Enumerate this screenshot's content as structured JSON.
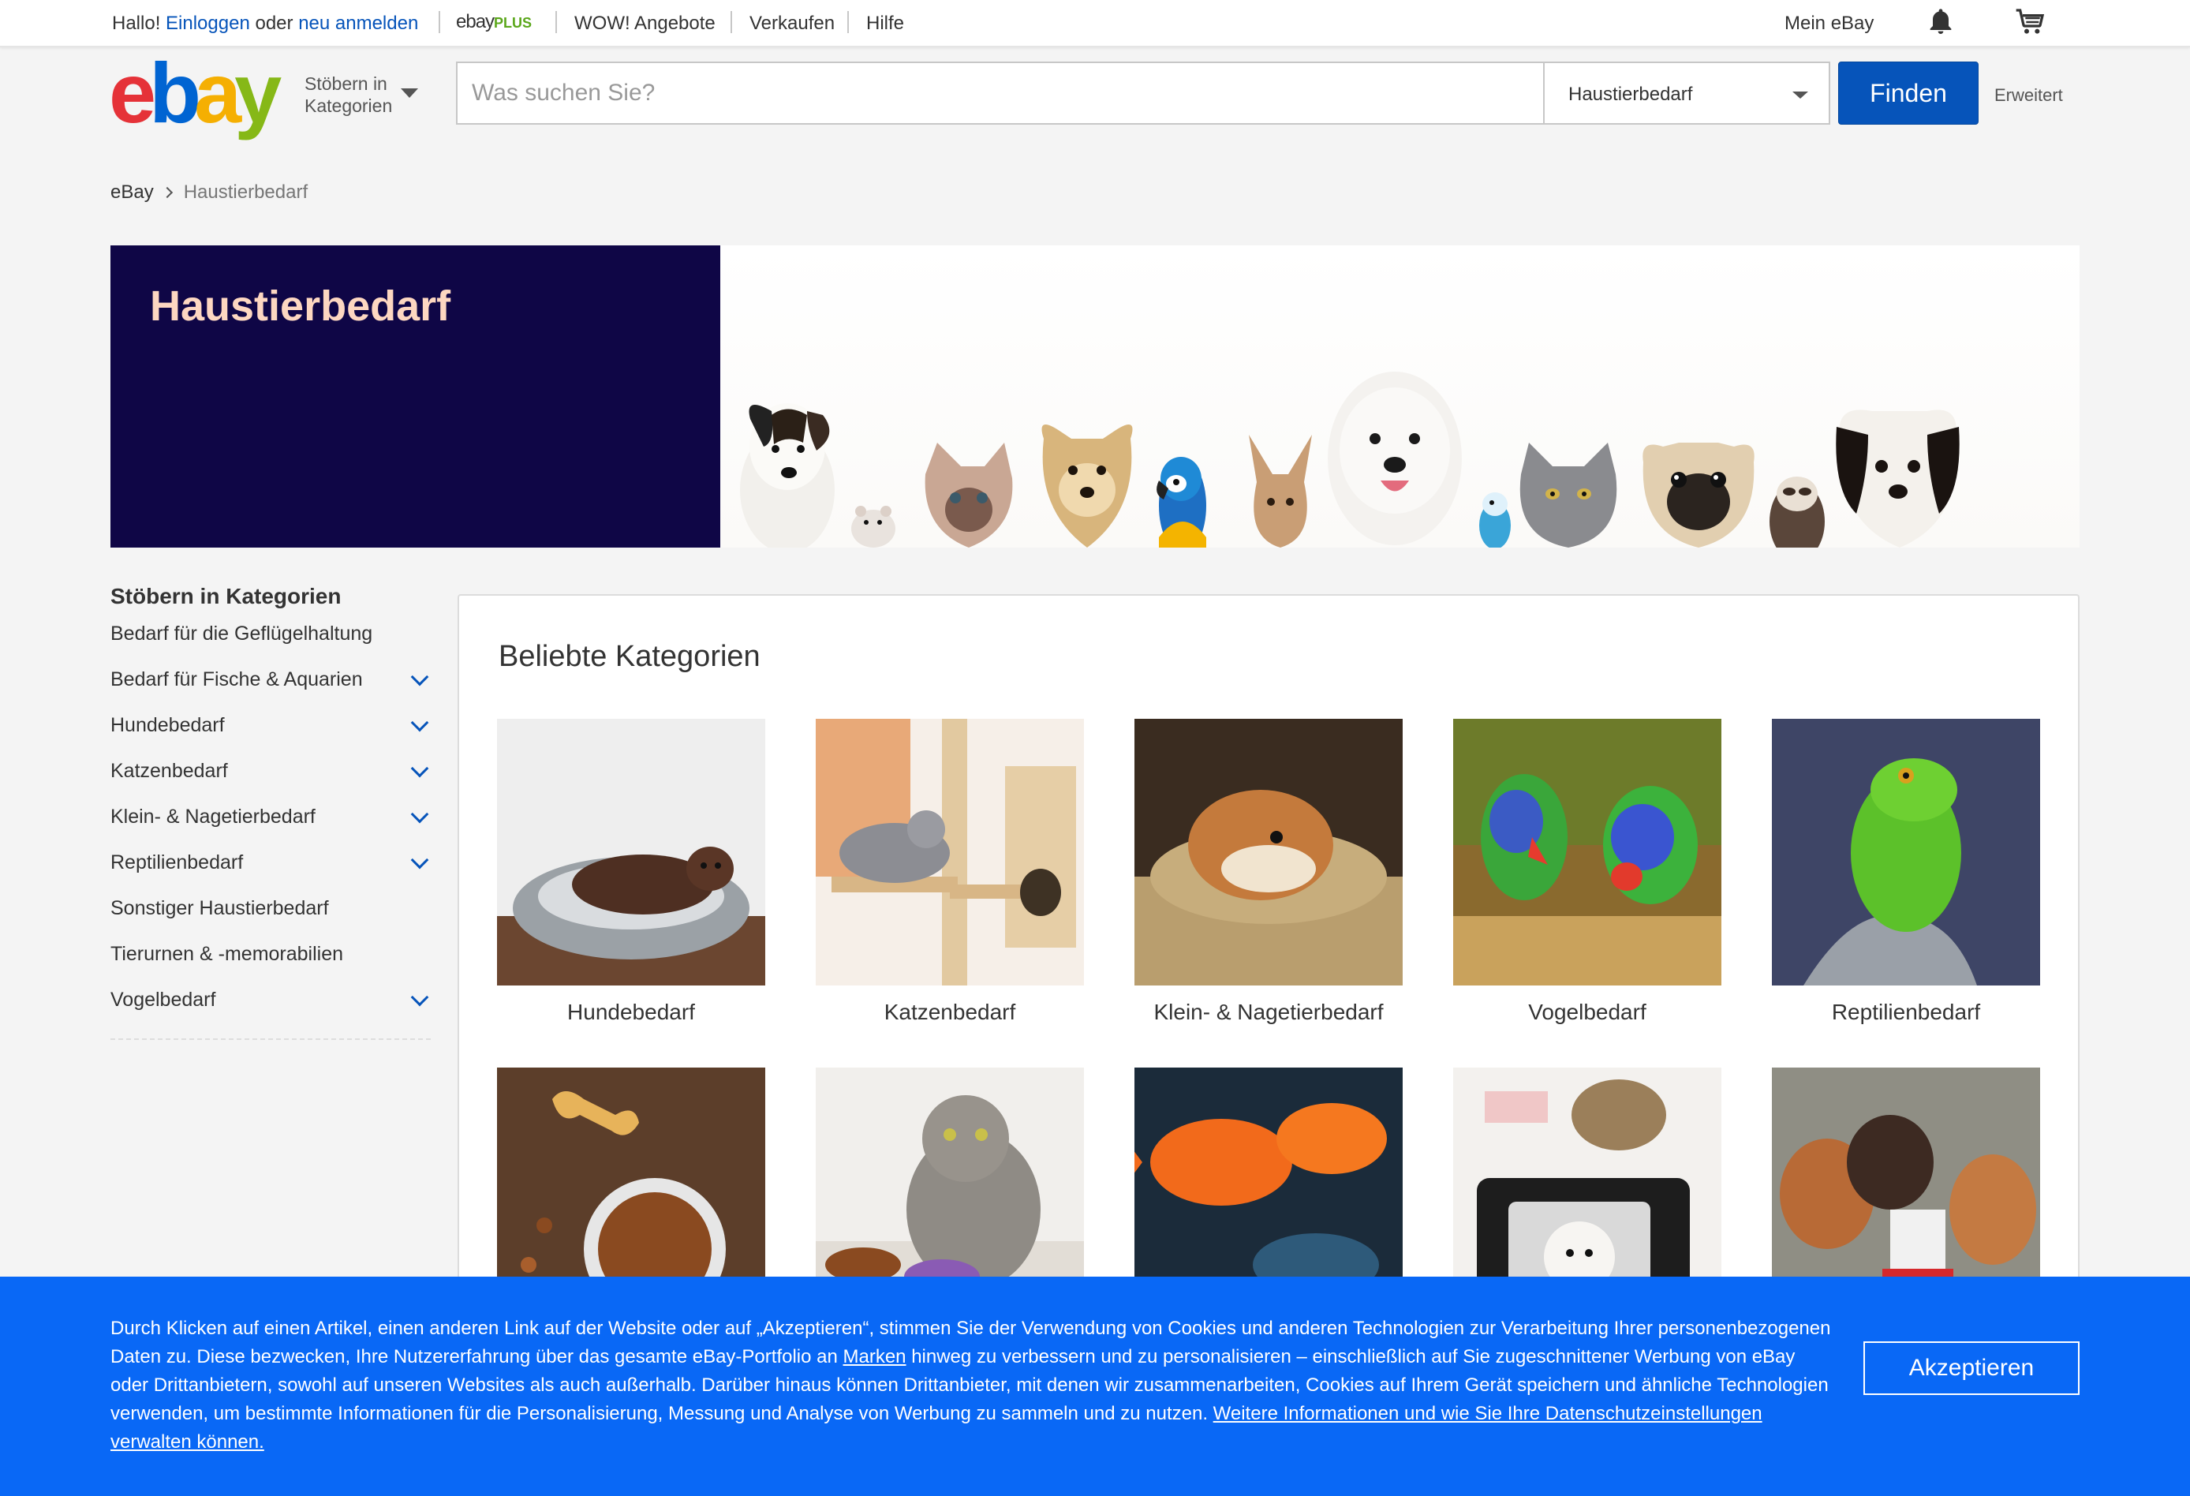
{
  "topbar": {
    "hello": "Hallo!",
    "signin": "Einloggen",
    "or": "oder",
    "register": "neu anmelden",
    "ebay_plus_word": "ebay",
    "ebay_plus_plus": "PLUS",
    "wow": "WOW! Angebote",
    "sell": "Verkaufen",
    "help": "Hilfe",
    "my_ebay": "Mein eBay",
    "icons": [
      "bell-icon",
      "cart-icon"
    ]
  },
  "header": {
    "logo": [
      "e",
      "b",
      "a",
      "y"
    ],
    "browse_categories": "Stöbern in Kategorien",
    "search_placeholder": "Was suchen Sie?",
    "search_value": "",
    "category_selected": "Haustierbedarf",
    "find_button": "Finden",
    "advanced": "Erweitert"
  },
  "breadcrumb": {
    "root": "eBay",
    "current": "Haustierbedarf"
  },
  "hero": {
    "title": "Haustierbedarf"
  },
  "sidebar": {
    "heading": "Stöbern in Kategorien",
    "items": [
      {
        "label": "Bedarf für die Geflügelhaltung",
        "expandable": false
      },
      {
        "label": "Bedarf für Fische & Aquarien",
        "expandable": true
      },
      {
        "label": "Hundebedarf",
        "expandable": true
      },
      {
        "label": "Katzenbedarf",
        "expandable": true
      },
      {
        "label": "Klein- & Nagetierbedarf",
        "expandable": true
      },
      {
        "label": "Reptilienbedarf",
        "expandable": true
      },
      {
        "label": "Sonstiger Haustierbedarf",
        "expandable": false
      },
      {
        "label": "Tierurnen & -memorabilien",
        "expandable": false
      },
      {
        "label": "Vogelbedarf",
        "expandable": true
      }
    ]
  },
  "popular": {
    "heading": "Beliebte Kategorien",
    "tiles": [
      {
        "label": "Hundebedarf"
      },
      {
        "label": "Katzenbedarf"
      },
      {
        "label": "Klein- & Nagetierbedarf"
      },
      {
        "label": "Vogelbedarf"
      },
      {
        "label": "Reptilienbedarf"
      },
      {
        "label": ""
      },
      {
        "label": ""
      },
      {
        "label": ""
      },
      {
        "label": ""
      },
      {
        "label": ""
      }
    ]
  },
  "cookie": {
    "text_1": "Durch Klicken auf einen Artikel, einen anderen Link auf der Website oder auf „Akzeptieren“, stimmen Sie der Verwendung von Cookies und anderen Technologien zur Verarbeitung Ihrer personenbezogenen Daten zu. Diese bezwecken, Ihre Nutzererfahrung über das gesamte eBay-Portfolio an ",
    "link_brands": "Marken",
    "text_2": " hinweg zu verbessern und zu personalisieren – einschließlich auf Sie zugeschnittener Werbung von eBay oder Drittanbietern, sowohl auf unseren Websites als auch außerhalb. Darüber hinaus können Drittanbieter, mit denen wir zusammenarbeiten, Cookies auf Ihrem Gerät speichern und ähnliche Technologien verwenden, um bestimmte Informationen für die Personalisierung, Messung und Analyse von Werbung zu sammeln und zu nutzen. ",
    "link_more": "Weitere Informationen und wie Sie Ihre Datenschutzeinstellungen verwalten können.",
    "accept": "Akzeptieren"
  }
}
